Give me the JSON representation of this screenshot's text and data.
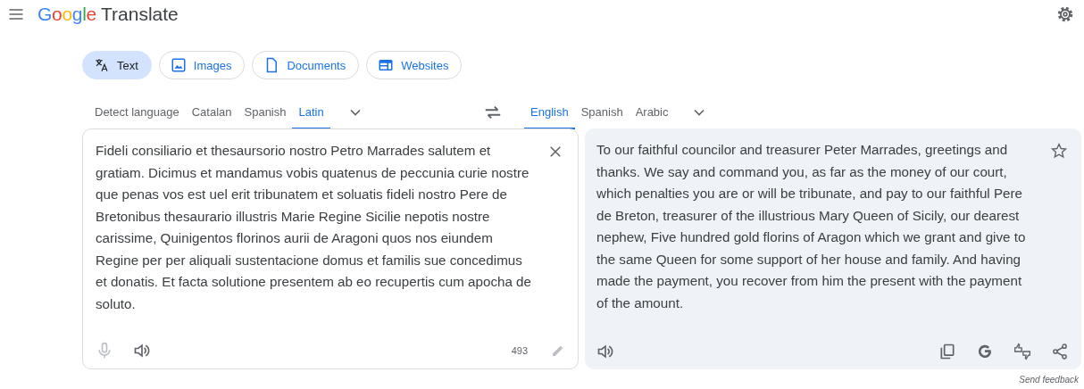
{
  "header": {
    "logo": "Google",
    "title": "Translate"
  },
  "modes": [
    {
      "label": "Text",
      "kind": "text",
      "selected": true
    },
    {
      "label": "Images",
      "kind": "images",
      "selected": false
    },
    {
      "label": "Documents",
      "kind": "documents",
      "selected": false
    },
    {
      "label": "Websites",
      "kind": "websites",
      "selected": false
    }
  ],
  "source_languages": [
    {
      "label": "Detect language",
      "selected": false
    },
    {
      "label": "Catalan",
      "selected": false
    },
    {
      "label": "Spanish",
      "selected": false
    },
    {
      "label": "Latin",
      "selected": true
    }
  ],
  "target_languages": [
    {
      "label": "English",
      "selected": true
    },
    {
      "label": "Spanish",
      "selected": false
    },
    {
      "label": "Arabic",
      "selected": false
    }
  ],
  "source": {
    "text": "Fideli consiliario et thesaursorio nostro Petro Marrades salutem et gratiam. Dicimus et mandamus vobis quatenus de peccunia curie nostre que penas vos est uel erit tribunatem et soluatis fideli nostro Pere de Bretonibus thesaurario illustris Marie Regine Sicilie nepotis nostre carissime, Quinigentos florinos aurii de Aragoni quos nos eiundem Regine per per aliquali sustentacione domus et familis sue concedimus et donatis. Et facta solutione presentem ab eo recupertis cum apocha de soluto.",
    "char_count": "493",
    "mic_disabled": true
  },
  "translation": {
    "text": "To our faithful councilor and treasurer Peter Marrades, greetings and thanks. We say and command you, as far as the money of our court, which penalties you are or will be tribunate, and pay to our faithful Pere de Breton, treasurer of the illustrious Mary Queen of Sicily, our dearest nephew, Five hundred gold florins of Aragon which we grant and give to the same Queen for some support of her house and family. And having made the payment, you recover from him the present with the payment of the amount.",
    "starred": false
  },
  "footer": {
    "link": "Send feedback"
  }
}
